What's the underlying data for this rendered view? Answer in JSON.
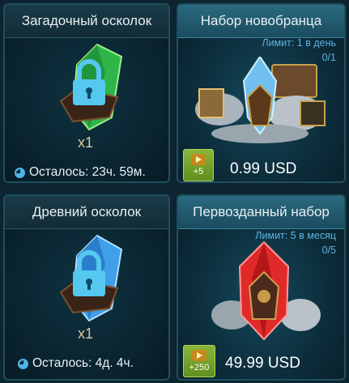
{
  "shards": [
    {
      "title": "Загадочный осколок",
      "count": "x1",
      "timer": "Осталось: 23ч. 59м.",
      "gem_color": "#2fb54a"
    },
    {
      "title": "Древний осколок",
      "count": "x1",
      "timer": "Осталось: 4д. 4ч.",
      "gem_color": "#3f9fe8"
    }
  ],
  "packs": [
    {
      "title": "Набор новобранца",
      "limit": "Лимит: 1 в день",
      "progress": "0/1",
      "bonus": "+5",
      "price": "0.99 USD",
      "accent": "#6fc0f0"
    },
    {
      "title": "Первозданный набор",
      "limit": "Лимит: 5 в месяц",
      "progress": "0/5",
      "bonus": "+250",
      "price": "49.99 USD",
      "accent": "#e02a2a"
    }
  ],
  "colors": {
    "lock": "#56c8f0",
    "limit_text": "#5cb4e2",
    "bonus_green": "#7aa830"
  }
}
